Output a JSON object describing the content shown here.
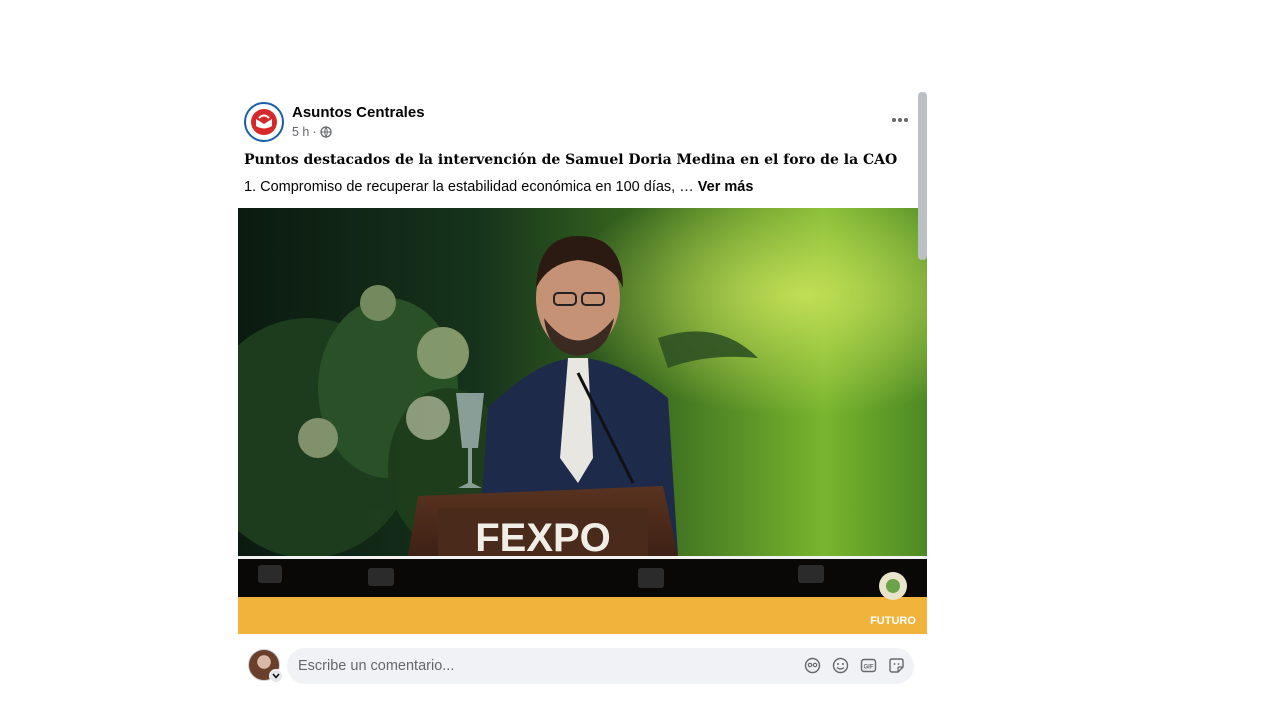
{
  "post": {
    "page_name": "Asuntos Centrales",
    "time": "5 h",
    "separator": "·",
    "audience_icon": "globe-icon",
    "more_icon": "more-horizontal-icon",
    "headline": "Puntos destacados de la intervención de Samuel Doria Medina en el foro de la CAO",
    "body_text": "1. Compromiso de recuperar la estabilidad económica en 100 días, … ",
    "see_more_label": "Ver más",
    "video": {
      "podium_text": "FEXPO",
      "corner_logo_text": "FUTURO"
    }
  },
  "comment": {
    "placeholder": "Escribe un comentario...",
    "icons": [
      "avatar-sticker-icon",
      "emoji-icon",
      "gif-icon",
      "sticker-icon"
    ]
  },
  "colors": {
    "accent": "#1b5fa8",
    "brand_red": "#d62a2a",
    "stage_yellow": "#f2b33d"
  }
}
